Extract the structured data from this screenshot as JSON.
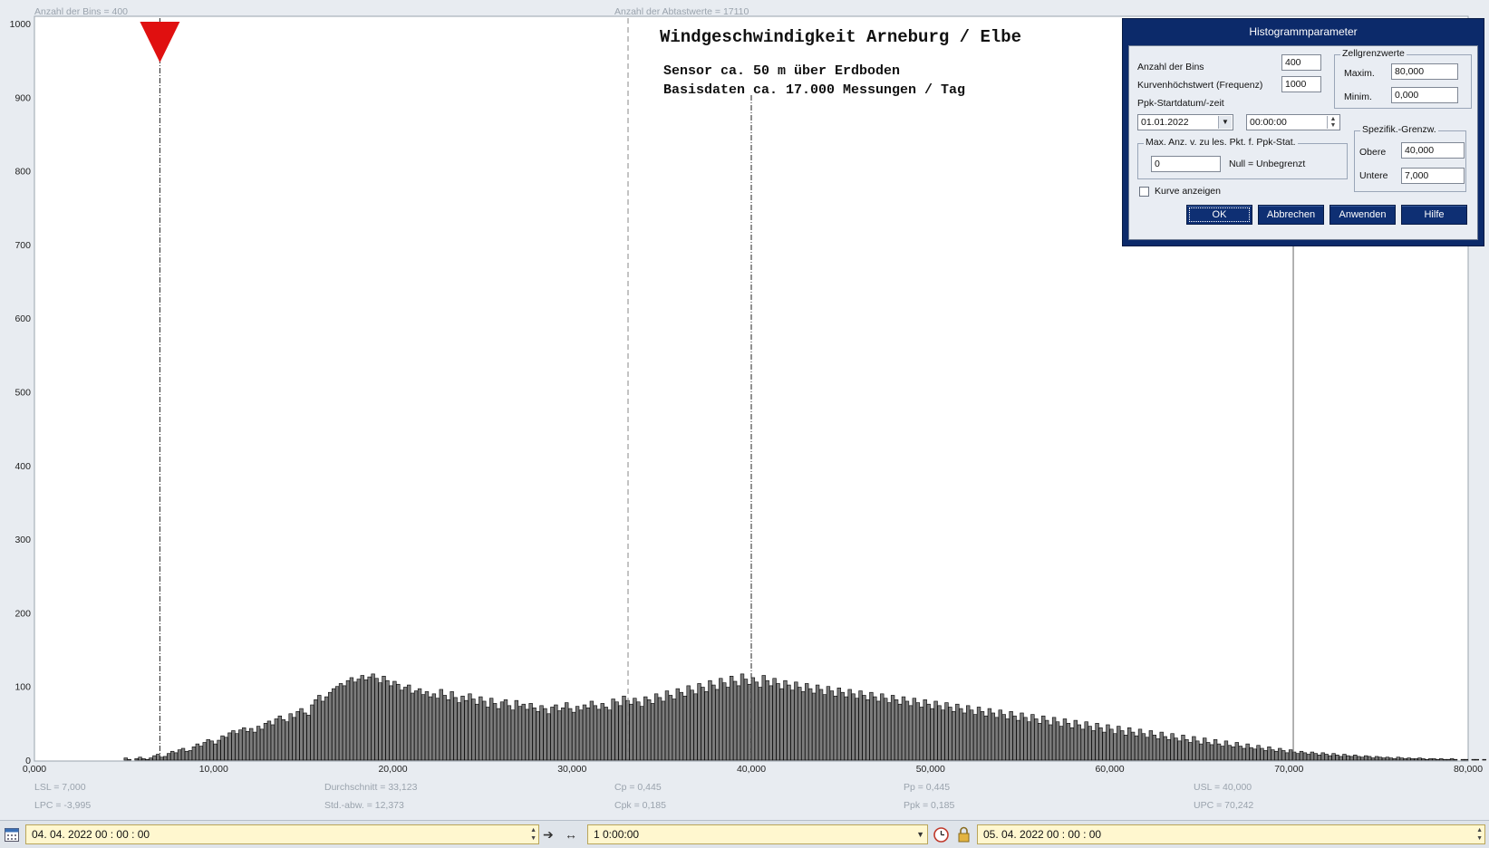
{
  "header": {
    "bins_label": "Anzahl der Bins =   400",
    "samples_label": "Anzahl der Abtastwerte = 17110"
  },
  "title": {
    "main": "Windgeschwindigkeit  Arneburg / Elbe",
    "line1": "Sensor ca. 50 m über Erdboden",
    "line2": "Basisdaten ca. 17.000 Messungen / Tag"
  },
  "stats": {
    "lsl": "LSL = 7,000",
    "lpc": "LPC = -3,995",
    "mean": "Durchschnitt  = 33,123",
    "std": "Std.-abw.  = 12,373",
    "cp": "Cp  = 0,445",
    "cpk": "Cpk = 0,185",
    "pp": "Pp  = 0,445",
    "ppk": "Ppk = 0,185",
    "usl": "USL = 40,000",
    "upc": "UPC = 70,242"
  },
  "colors": {
    "background": "#e8ecf1",
    "bar_fill": "#7c7c7c",
    "marker": "#e01010",
    "dialog_frame": "#0c2a6a"
  },
  "chart_data": {
    "type": "bar",
    "xlim": [
      0,
      80
    ],
    "ylim": [
      0,
      1000
    ],
    "x_ticks": [
      "0,000",
      "10,000",
      "20,000",
      "30,000",
      "40,000",
      "50,000",
      "60,000",
      "70,000",
      "80,000"
    ],
    "y_ticks": [
      "0",
      "100",
      "200",
      "300",
      "400",
      "500",
      "600",
      "700",
      "800",
      "900",
      "1000"
    ],
    "bin_width": 0.2,
    "bins_start": 5.0,
    "values": [
      3,
      1,
      0,
      2,
      4,
      2,
      1,
      3,
      6,
      8,
      4,
      5,
      9,
      12,
      10,
      14,
      16,
      12,
      13,
      18,
      22,
      19,
      24,
      28,
      26,
      22,
      27,
      33,
      31,
      37,
      40,
      36,
      41,
      44,
      39,
      43,
      38,
      46,
      42,
      50,
      53,
      48,
      56,
      60,
      55,
      52,
      63,
      58,
      66,
      70,
      64,
      61,
      75,
      82,
      88,
      80,
      86,
      92,
      97,
      100,
      104,
      101,
      108,
      112,
      106,
      110,
      115,
      109,
      113,
      117,
      111,
      105,
      114,
      108,
      101,
      107,
      103,
      95,
      99,
      102,
      91,
      94,
      97,
      89,
      93,
      86,
      90,
      84,
      96,
      88,
      82,
      93,
      85,
      78,
      87,
      81,
      90,
      83,
      76,
      86,
      80,
      72,
      84,
      77,
      70,
      79,
      82,
      74,
      68,
      81,
      73,
      76,
      69,
      77,
      71,
      66,
      74,
      70,
      63,
      72,
      75,
      67,
      71,
      78,
      70,
      65,
      73,
      68,
      75,
      71,
      80,
      74,
      69,
      77,
      72,
      68,
      83,
      79,
      74,
      87,
      81,
      76,
      84,
      79,
      73,
      86,
      82,
      77,
      90,
      85,
      80,
      94,
      88,
      83,
      97,
      92,
      87,
      101,
      95,
      90,
      104,
      99,
      93,
      108,
      102,
      96,
      111,
      105,
      99,
      114,
      107,
      101,
      117,
      110,
      103,
      112,
      106,
      99,
      115,
      108,
      101,
      111,
      104,
      97,
      108,
      102,
      95,
      106,
      99,
      93,
      104,
      97,
      91,
      102,
      96,
      89,
      100,
      94,
      87,
      98,
      92,
      86,
      96,
      90,
      84,
      94,
      88,
      82,
      92,
      86,
      80,
      90,
      84,
      78,
      88,
      82,
      76,
      86,
      80,
      74,
      84,
      78,
      72,
      82,
      76,
      70,
      80,
      74,
      68,
      78,
      72,
      66,
      76,
      70,
      64,
      74,
      68,
      62,
      72,
      66,
      60,
      70,
      64,
      58,
      68,
      62,
      56,
      66,
      60,
      54,
      64,
      58,
      52,
      62,
      56,
      50,
      60,
      54,
      48,
      58,
      52,
      46,
      56,
      50,
      44,
      54,
      48,
      42,
      52,
      46,
      40,
      50,
      44,
      38,
      48,
      42,
      36,
      46,
      40,
      34,
      44,
      38,
      33,
      42,
      36,
      31,
      40,
      34,
      29,
      38,
      32,
      28,
      36,
      30,
      26,
      34,
      28,
      24,
      32,
      26,
      22,
      30,
      24,
      21,
      28,
      22,
      19,
      26,
      20,
      18,
      24,
      19,
      16,
      22,
      17,
      15,
      20,
      16,
      13,
      18,
      14,
      12,
      16,
      13,
      10,
      14,
      11,
      9,
      12,
      10,
      8,
      11,
      9,
      7,
      10,
      8,
      6,
      9,
      7,
      5,
      8,
      6,
      5,
      7,
      5,
      4,
      6,
      5,
      3,
      5,
      4,
      3,
      4,
      3,
      2,
      4,
      3,
      2,
      3,
      2,
      2,
      3,
      2,
      1,
      2,
      2,
      1,
      2,
      1,
      1,
      2,
      1,
      0,
      1,
      1,
      0,
      1,
      1,
      0,
      1,
      0,
      0,
      1,
      0
    ],
    "lines": {
      "lsl": 7.0,
      "mean": 33.123,
      "usl": 40.0,
      "upc": 70.242
    },
    "marker_x": 7.0
  },
  "dialog": {
    "title": "Histogrammparameter",
    "bins_label": "Anzahl der Bins",
    "bins_value": "400",
    "freq_label": "Kurvenhöchstwert (Frequenz)",
    "freq_value": "1000",
    "start_label": "Ppk-Startdatum/-zeit",
    "start_date": "01.01.2022",
    "start_time": "00:00:00",
    "cell_group": "Zellgrenzwerte",
    "max_label": "Maxim.",
    "max_value": "80,000",
    "min_label": "Minim.",
    "min_value": "0,000",
    "maxpts_group": "Max. Anz. v. zu les. Pkt. f. Ppk-Stat.",
    "maxpts_value": "0",
    "null_label": "Null = Unbegrenzt",
    "spec_group": "Spezifik.-Grenzw.",
    "upper_label": "Obere",
    "upper_value": "40,000",
    "lower_label": "Untere",
    "lower_value": "7,000",
    "curve_label": "Kurve anzeigen",
    "ok": "OK",
    "cancel": "Abbrechen",
    "apply": "Anwenden",
    "help": "Hilfe"
  },
  "bottom": {
    "start": "04. 04.  2022    00 : 00 : 00",
    "interval": "1  0:00:00",
    "end": "05. 04.  2022    00 : 00 : 00",
    "calendar_icon": "calendar-icon",
    "shrink_icon": "arrows-inward-icon",
    "expand_icon": "arrows-outward-icon",
    "clock_icon": "clock-icon",
    "lock_icon": "lock-icon"
  }
}
